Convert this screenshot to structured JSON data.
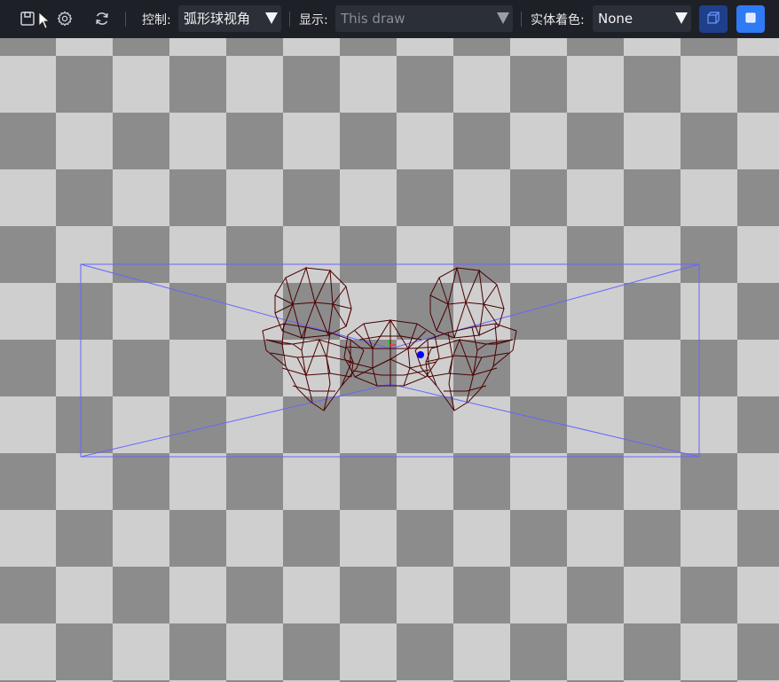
{
  "toolbar": {
    "icons": {
      "save": "save-icon",
      "cursor": "cursor-icon",
      "settings": "gear-icon",
      "reset": "refresh-icon"
    },
    "control_label": "控制:",
    "control_value": "弧形球视角",
    "display_label": "显示:",
    "display_value": "This draw",
    "shading_label": "实体着色:",
    "shading_value": "None",
    "view_buttons": {
      "wireframe": "cube-wireframe-icon",
      "solid": "cube-solid-icon"
    }
  },
  "viewport": {
    "background": "checkerboard",
    "colors": {
      "checker_light": "#cfcfcf",
      "checker_dark": "#8c8c8c",
      "mesh": "#4a0000",
      "frustum": "#6666ff",
      "pivot": "#0000ff"
    }
  }
}
